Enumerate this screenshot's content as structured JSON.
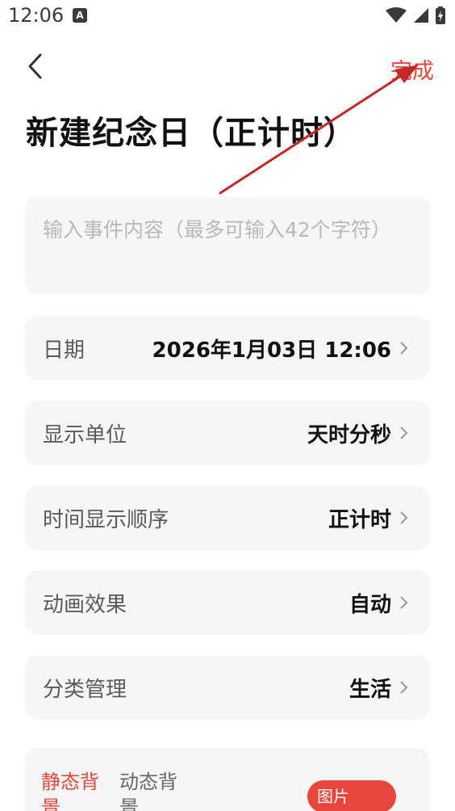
{
  "status_bar": {
    "time": "12:06",
    "badge": "A"
  },
  "nav": {
    "done_label": "完成"
  },
  "title": "新建纪念日（正计时）",
  "event_input": {
    "placeholder": "输入事件内容（最多可输入42个字符）"
  },
  "rows": [
    {
      "label": "日期",
      "value": "2026年1月03日 12:06"
    },
    {
      "label": "显示单位",
      "value": "天时分秒"
    },
    {
      "label": "时间显示顺序",
      "value": "正计时"
    },
    {
      "label": "动画效果",
      "value": "自动"
    },
    {
      "label": "分类管理",
      "value": "生活"
    }
  ],
  "background": {
    "tabs": [
      {
        "label": "静态背景"
      },
      {
        "label": "动态背景"
      }
    ],
    "image_button": "图片"
  },
  "colors": {
    "accent": "#e8453c",
    "card": "#f6f6f6",
    "annotation_arrow": "#c62828"
  }
}
